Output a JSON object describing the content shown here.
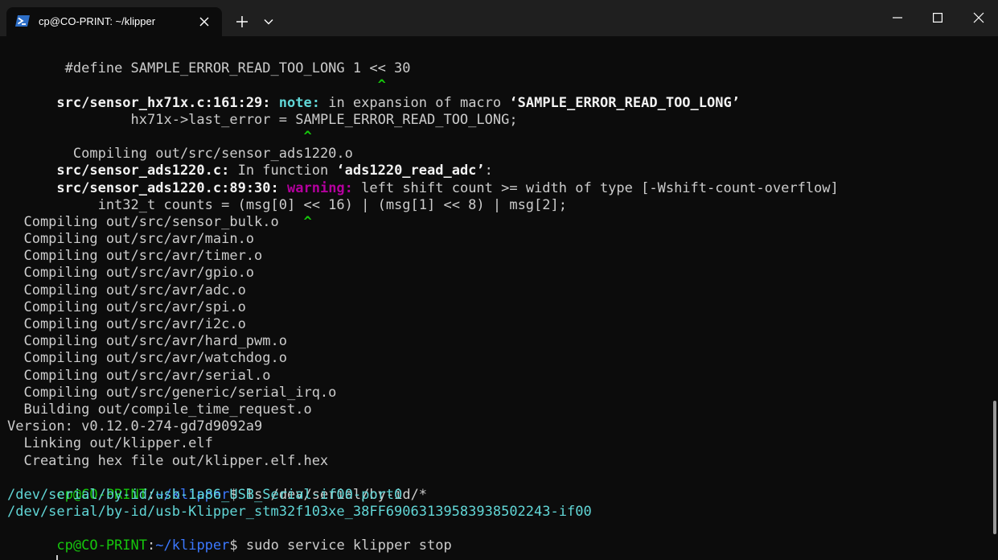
{
  "window": {
    "tab_title": "cp@CO-PRINT: ~/klipper",
    "icons": {
      "tab": "powershell-icon",
      "tab_close": "close-icon",
      "new_tab": "plus-icon",
      "dropdown": "chevron-down-icon",
      "minimize": "minimize-icon",
      "maximize": "maximize-icon",
      "close": "close-icon"
    }
  },
  "colors": {
    "background": "#0c0c0c",
    "titlebar": "#1f1f1f",
    "text": "#cccccc",
    "prompt_user": "#16c60c",
    "prompt_path": "#3b78ff",
    "note": "#61d6d6",
    "warning": "#b4009e",
    "caret": "#16c60c"
  },
  "terminal": {
    "l1": " #define SAMPLE_ERROR_READ_TOO_LONG 1 << 30",
    "l2_pad": "                                       ",
    "l2_caret": "^",
    "l3_file": "src/sensor_hx71x.c:161:29:",
    "l3_kind": "note:",
    "l3_msg_a": " in expansion of macro ",
    "l3_macro": "‘SAMPLE_ERROR_READ_TOO_LONG’",
    "l4": "         hx71x->last_error = SAMPLE_ERROR_READ_TOO_LONG;",
    "l5_pad": "                              ",
    "l5_caret": "^",
    "l6": "  Compiling out/src/sensor_ads1220.o",
    "l7_file": "src/sensor_ads1220.c:",
    "l7_msg": " In function ",
    "l7_func": "‘ads1220_read_adc’",
    "l7_end": ":",
    "l8_file": "src/sensor_ads1220.c:89:30:",
    "l8_kind": "warning:",
    "l8_msg": " left shift count >= width of type [-Wshift-count-overflow]",
    "l9": "     int32_t counts = (msg[0] << 16) | (msg[1] << 8) | msg[2];",
    "l10_pad": "                              ",
    "l10_caret": "^",
    "compile_lines": [
      "  Compiling out/src/sensor_bulk.o",
      "  Compiling out/src/avr/main.o",
      "  Compiling out/src/avr/timer.o",
      "  Compiling out/src/avr/gpio.o",
      "  Compiling out/src/avr/adc.o",
      "  Compiling out/src/avr/spi.o",
      "  Compiling out/src/avr/i2c.o",
      "  Compiling out/src/avr/hard_pwm.o",
      "  Compiling out/src/avr/watchdog.o",
      "  Compiling out/src/avr/serial.o",
      "  Compiling out/src/generic/serial_irq.o",
      "  Building out/compile_time_request.o"
    ],
    "version": "Version: v0.12.0-274-gd7d9092a9",
    "linking": "  Linking out/klipper.elf",
    "hexfile": "  Creating hex file out/klipper.elf.hex",
    "prompt_user": "cp@CO-PRINT",
    "prompt_colon": ":",
    "prompt_path": "~/klipper",
    "prompt_dollar": "$ ",
    "cmd1": "ls /dev/serial/by-id/*",
    "out1": "/dev/serial/by-id/usb-1a86_USB_Serial-if00-port0",
    "out2": "/dev/serial/by-id/usb-Klipper_stm32f103xe_38FF6906313958393850224З-if00",
    "cmd2": "sudo service klipper stop"
  }
}
